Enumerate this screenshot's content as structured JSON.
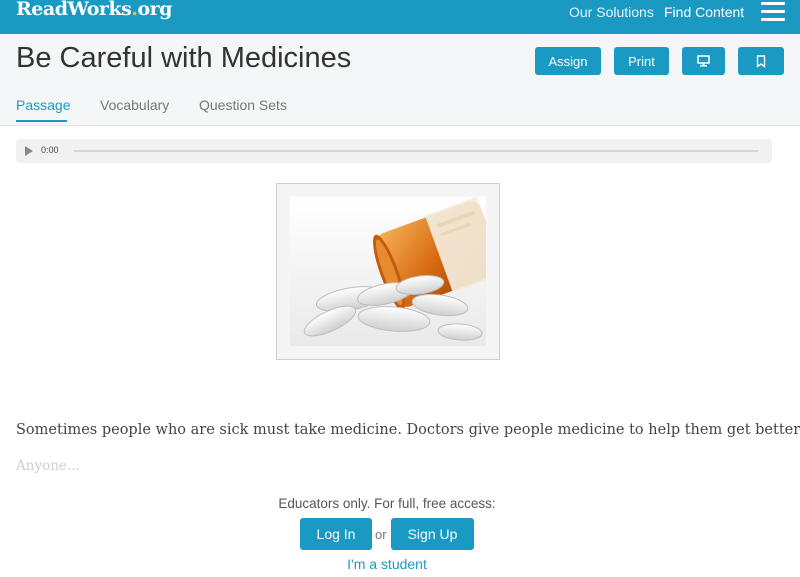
{
  "topbar": {
    "logo": {
      "name": "ReadWorks",
      "dot": ".",
      "tld": "org"
    },
    "nav": [
      {
        "label": "Our Solutions"
      },
      {
        "label": "Find Content"
      }
    ],
    "menu_icon": "hamburger-menu-icon",
    "background": "#1a9ac3",
    "logo_accent": "#f3c23a"
  },
  "header": {
    "title": "Be Careful with Medicines",
    "buttons": {
      "assign": "Assign",
      "print": "Print"
    },
    "icons": {
      "present": "monitor-icon",
      "bookmark": "bookmark-icon"
    },
    "tabs": [
      {
        "label": "Passage"
      },
      {
        "label": "Vocabulary"
      },
      {
        "label": "Question Sets"
      }
    ],
    "active_tab": "Passage"
  },
  "audio": {
    "time": "0:00",
    "progress": 0,
    "icon": "play-icon"
  },
  "passage": {
    "image_icon": "pill-bottle-image",
    "text": "Sometimes people who are sick must take medicine. Doctors give people medicine to help them get better.",
    "fade_text": "Anyone..."
  },
  "access": {
    "message": "Educators only. For full, free access:",
    "login": "Log In",
    "or": "or",
    "signup": "Sign Up",
    "student_link": "I'm a student"
  },
  "colors": {
    "accent": "#1a9ac3",
    "text": "#333333"
  }
}
